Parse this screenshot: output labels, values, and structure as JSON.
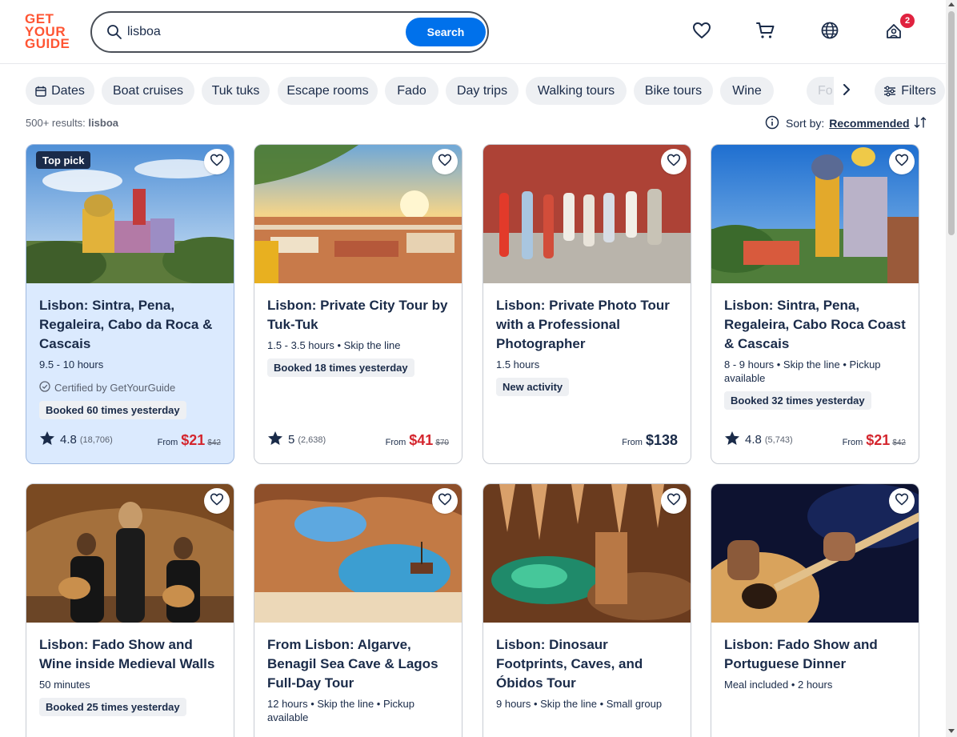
{
  "brand": {
    "logo_lines": [
      "GET",
      "YOUR",
      "GUIDE"
    ],
    "accent": "#ff5533",
    "primary": "#0071eb",
    "price_red": "#d4262e"
  },
  "search": {
    "value": "lisboa",
    "button_label": "Search"
  },
  "header_icons": {
    "wishlist": "heart-icon",
    "cart": "cart-icon",
    "language": "globe-icon",
    "profile": "profile-icon",
    "profile_badge": "2"
  },
  "chips": [
    "Dates",
    "Boat cruises",
    "Tuk tuks",
    "Escape rooms",
    "Fado",
    "Day trips",
    "Walking tours",
    "Bike tours",
    "Wine",
    "Fo"
  ],
  "filters_label": "Filters",
  "results": {
    "count": "500+ results:",
    "query": "lisboa"
  },
  "sort": {
    "label": "Sort by:",
    "value": "Recommended"
  },
  "cards": [
    {
      "badge": "Top pick",
      "title": "Lisbon: Sintra, Pena, Regaleira, Cabo da Roca & Cascais",
      "meta": "9.5 - 10 hours",
      "certified": "Certified by GetYourGuide",
      "tag": "Booked 60 times yesterday",
      "rating": "4.8",
      "reviews": "(18,706)",
      "from": "From",
      "price": "$21",
      "old_price": "$42"
    },
    {
      "title": "Lisbon: Private City Tour by Tuk-Tuk",
      "meta": "1.5 - 3.5 hours • Skip the line",
      "tag": "Booked 18 times yesterday",
      "rating": "5",
      "reviews": "(2,638)",
      "from": "From",
      "price": "$41",
      "old_price": "$70"
    },
    {
      "title": "Lisbon: Private Photo Tour with a Professional Photographer",
      "meta": "1.5 hours",
      "tag": "New activity",
      "from": "From",
      "price": "$138"
    },
    {
      "title": "Lisbon: Sintra, Pena, Regaleira, Cabo Roca Coast & Cascais",
      "meta": "8 - 9 hours • Skip the line • Pickup available",
      "tag": "Booked 32 times yesterday",
      "rating": "4.8",
      "reviews": "(5,743)",
      "from": "From",
      "price": "$21",
      "old_price": "$42"
    },
    {
      "title": "Lisbon: Fado Show and Wine inside Medieval Walls",
      "meta": "50 minutes",
      "tag": "Booked 25 times yesterday"
    },
    {
      "title": "From Lisbon: Algarve, Benagil Sea Cave & Lagos Full-Day Tour",
      "meta": "12 hours • Skip the line • Pickup available"
    },
    {
      "title": "Lisbon: Dinosaur Footprints, Caves, and Óbidos Tour",
      "meta": "9 hours • Skip the line • Small group"
    },
    {
      "title": "Lisbon: Fado Show and Portuguese Dinner",
      "meta": "Meal included • 2 hours"
    }
  ]
}
